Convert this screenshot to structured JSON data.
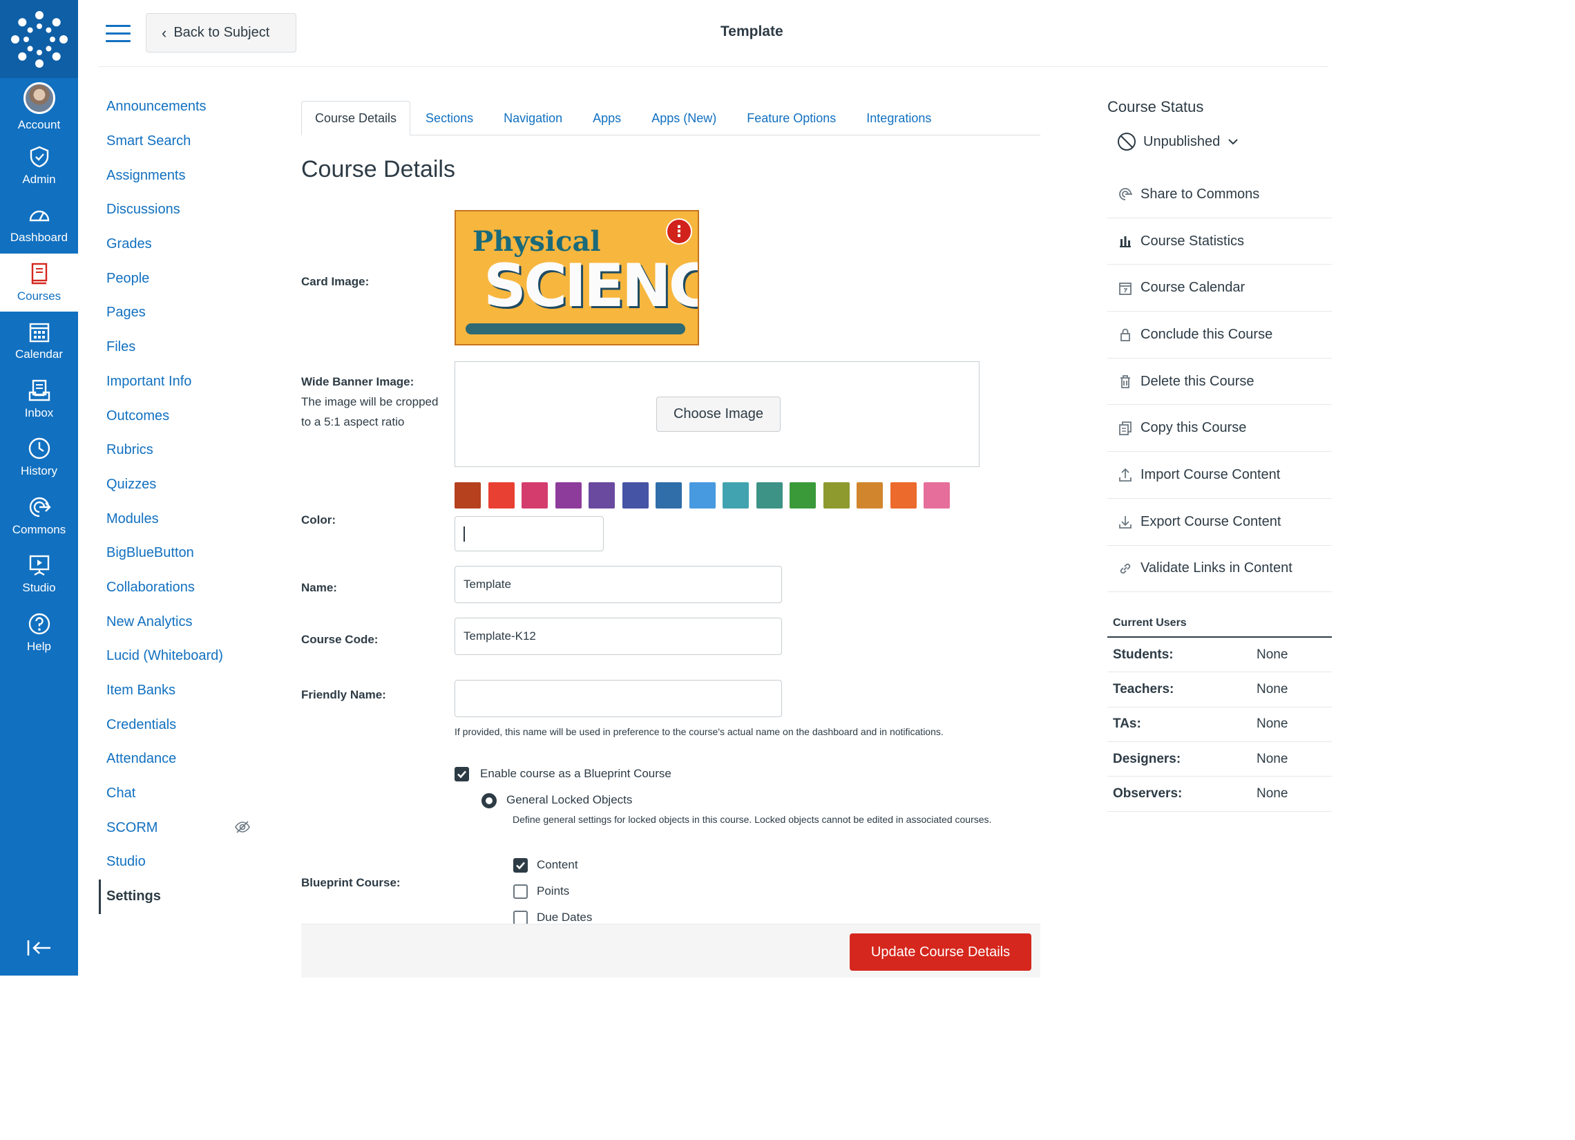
{
  "global_nav": {
    "items": [
      {
        "label": "Account",
        "icon": "avatar"
      },
      {
        "label": "Admin",
        "icon": "shield-icon"
      },
      {
        "label": "Dashboard",
        "icon": "dashboard-icon"
      },
      {
        "label": "Courses",
        "icon": "book-icon",
        "active": true
      },
      {
        "label": "Calendar",
        "icon": "calendar-icon"
      },
      {
        "label": "Inbox",
        "icon": "inbox-icon"
      },
      {
        "label": "History",
        "icon": "clock-icon"
      },
      {
        "label": "Commons",
        "icon": "commons-icon"
      },
      {
        "label": "Studio",
        "icon": "studio-icon"
      },
      {
        "label": "Help",
        "icon": "help-icon"
      }
    ]
  },
  "header": {
    "back_label": "Back to Subject",
    "title": "Template"
  },
  "course_nav": [
    "Announcements",
    "Smart Search",
    "Assignments",
    "Discussions",
    "Grades",
    "People",
    "Pages",
    "Files",
    "Important Info",
    "Outcomes",
    "Rubrics",
    "Quizzes",
    "Modules",
    "BigBlueButton",
    "Collaborations",
    "New Analytics",
    "Lucid (Whiteboard)",
    "Item Banks",
    "Credentials",
    "Attendance",
    "Chat",
    "SCORM",
    "Studio",
    "Settings"
  ],
  "tabs": [
    "Course Details",
    "Sections",
    "Navigation",
    "Apps",
    "Apps (New)",
    "Feature Options",
    "Integrations"
  ],
  "main": {
    "heading": "Course Details",
    "card_image_label": "Card Image:",
    "card_image_text_1": "Physical",
    "card_image_text_2": "SCIENCE",
    "banner_label": "Wide Banner Image:",
    "banner_help": "The image will be cropped to a 5:1 aspect ratio",
    "choose_image": "Choose Image",
    "color_label": "Color:",
    "swatch_colors": [
      "#b5411f",
      "#e84133",
      "#d43c6e",
      "#8e3c9c",
      "#6a4a9f",
      "#4554a4",
      "#2f6ea8",
      "#479ae0",
      "#42a3b0",
      "#3d9386",
      "#3a9a3a",
      "#8e9a2e",
      "#d1852c",
      "#ec6a2b",
      "#e56e9a"
    ],
    "name_label": "Name:",
    "name_value": "Template",
    "code_label": "Course Code:",
    "code_value": "Template-K12",
    "friendly_label": "Friendly Name:",
    "friendly_value": "",
    "friendly_hint": "If provided, this name will be used in preference to the course's actual name on the dashboard and in notifications.",
    "blueprint_label": "Blueprint Course:",
    "blueprint_enable": "Enable course as a Blueprint Course",
    "locked_title": "General Locked Objects",
    "locked_desc": "Define general settings for locked objects in this course. Locked objects cannot be edited in associated courses.",
    "opt_content": "Content",
    "opt_points": "Points",
    "opt_due": "Due Dates",
    "update_button": "Update Course Details"
  },
  "right": {
    "status_title": "Course Status",
    "status_value": "Unpublished",
    "actions": [
      {
        "label": "Share to Commons",
        "icon": "commons-icon"
      },
      {
        "label": "Course Statistics",
        "icon": "bar-chart-icon"
      },
      {
        "label": "Course Calendar",
        "icon": "calendar-icon"
      },
      {
        "label": "Conclude this Course",
        "icon": "lock-icon"
      },
      {
        "label": "Delete this Course",
        "icon": "trash-icon"
      },
      {
        "label": "Copy this Course",
        "icon": "copy-icon"
      },
      {
        "label": "Import Course Content",
        "icon": "upload-icon"
      },
      {
        "label": "Export Course Content",
        "icon": "download-icon"
      },
      {
        "label": "Validate Links in Content",
        "icon": "link-icon"
      }
    ],
    "users_title": "Current Users",
    "users": [
      {
        "role": "Students:",
        "value": "None"
      },
      {
        "role": "Teachers:",
        "value": "None"
      },
      {
        "role": "TAs:",
        "value": "None"
      },
      {
        "role": "Designers:",
        "value": "None"
      },
      {
        "role": "Observers:",
        "value": "None"
      }
    ]
  }
}
